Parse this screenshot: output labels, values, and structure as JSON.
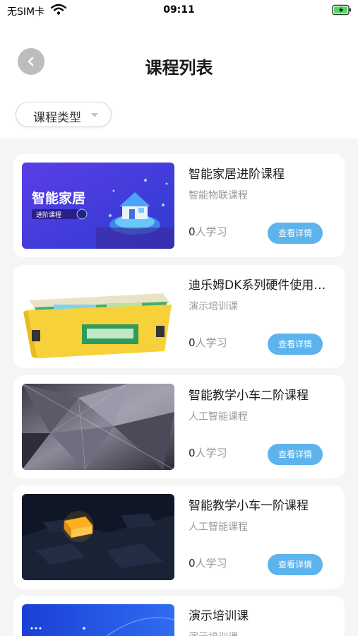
{
  "status_bar": {
    "carrier": "无SIM卡",
    "time": "09:11"
  },
  "header": {
    "title": "课程列表"
  },
  "filter": {
    "label": "课程类型"
  },
  "course_list": [
    {
      "title": "智能家居进阶课程",
      "category": "智能物联课程",
      "learners": "0",
      "learners_suffix": "人学习",
      "button": "查看详情",
      "thumb_text": "智能家居",
      "thumb_sub": "进阶课程"
    },
    {
      "title": "迪乐姆DK系列硬件使用课程",
      "category": "演示培训课",
      "learners": "0",
      "learners_suffix": "人学习",
      "button": "查看详情"
    },
    {
      "title": "智能教学小车二阶课程",
      "category": "人工智能课程",
      "learners": "0",
      "learners_suffix": "人学习",
      "button": "查看详情"
    },
    {
      "title": "智能教学小车一阶课程",
      "category": "人工智能课程",
      "learners": "0",
      "learners_suffix": "人学习",
      "button": "查看详情"
    },
    {
      "title": "演示培训课",
      "category": "演示培训课"
    }
  ],
  "colors": {
    "accent": "#5db3ec",
    "back_button": "#bdbdbd",
    "page_bg": "#f5f5f5"
  }
}
